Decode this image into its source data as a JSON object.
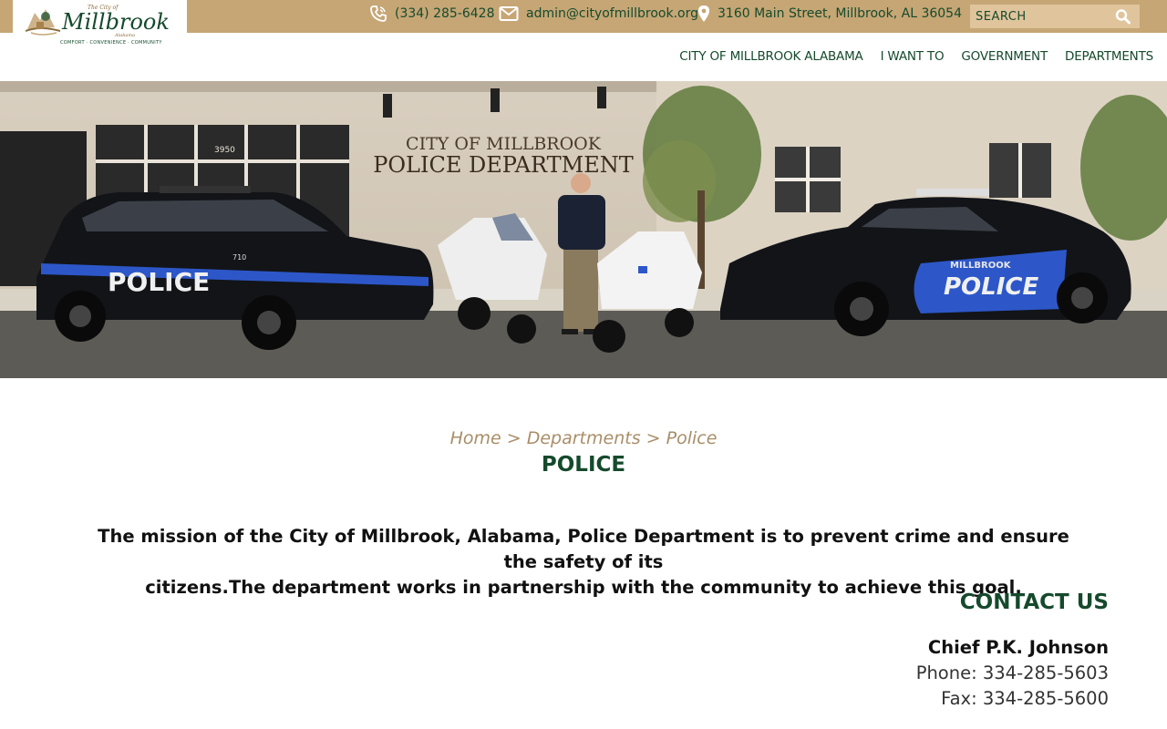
{
  "brand": {
    "logo_alt": "City of Millbrook Alabama",
    "logo_small_text": "The City of",
    "logo_name": "Millbrook",
    "logo_state": "Alabama",
    "logo_tagline": "COMFORT · CONVENIENCE · COMMUNITY",
    "colors": {
      "gold": "#c6a675",
      "green": "#154a2c",
      "breadcrumb": "#a98e68"
    }
  },
  "topbar": {
    "phone": "(334) 285-6428",
    "email": "admin@cityofmillbrook.org",
    "address": "3160 Main Street, Millbrook, AL 36054",
    "search_placeholder": "SEARCH",
    "icons": {
      "phone": "phone-icon",
      "email": "envelope-icon",
      "address": "map-pin-icon",
      "search": "magnifier-icon"
    }
  },
  "nav": {
    "items": [
      "CITY OF MILLBROOK ALABAMA",
      "I WANT TO",
      "GOVERNMENT",
      "DEPARTMENTS"
    ]
  },
  "hero": {
    "sign_line1": "CITY OF MILLBROOK",
    "sign_line2": "POLICE DEPARTMENT",
    "car_left_text": "POLICE",
    "car_right_brand": "MILLBROOK",
    "car_right_text": "POLICE",
    "building_number": "3950",
    "unit_number": "710"
  },
  "breadcrumb": {
    "home": "Home",
    "sep1": ">",
    "departments": "Departments",
    "sep2": ">",
    "current": "Police"
  },
  "page": {
    "title": "POLICE",
    "mission_line1": "The mission of the City of Millbrook, Alabama, Police Department is to prevent crime and ensure the safety of its",
    "mission_line2": "citizens.The department works in partnership with the community to achieve this goal."
  },
  "contact": {
    "heading": "CONTACT US",
    "name": "Chief P.K. Johnson",
    "phone": "Phone: 334-285-5603",
    "fax": "Fax: 334-285-5600"
  }
}
